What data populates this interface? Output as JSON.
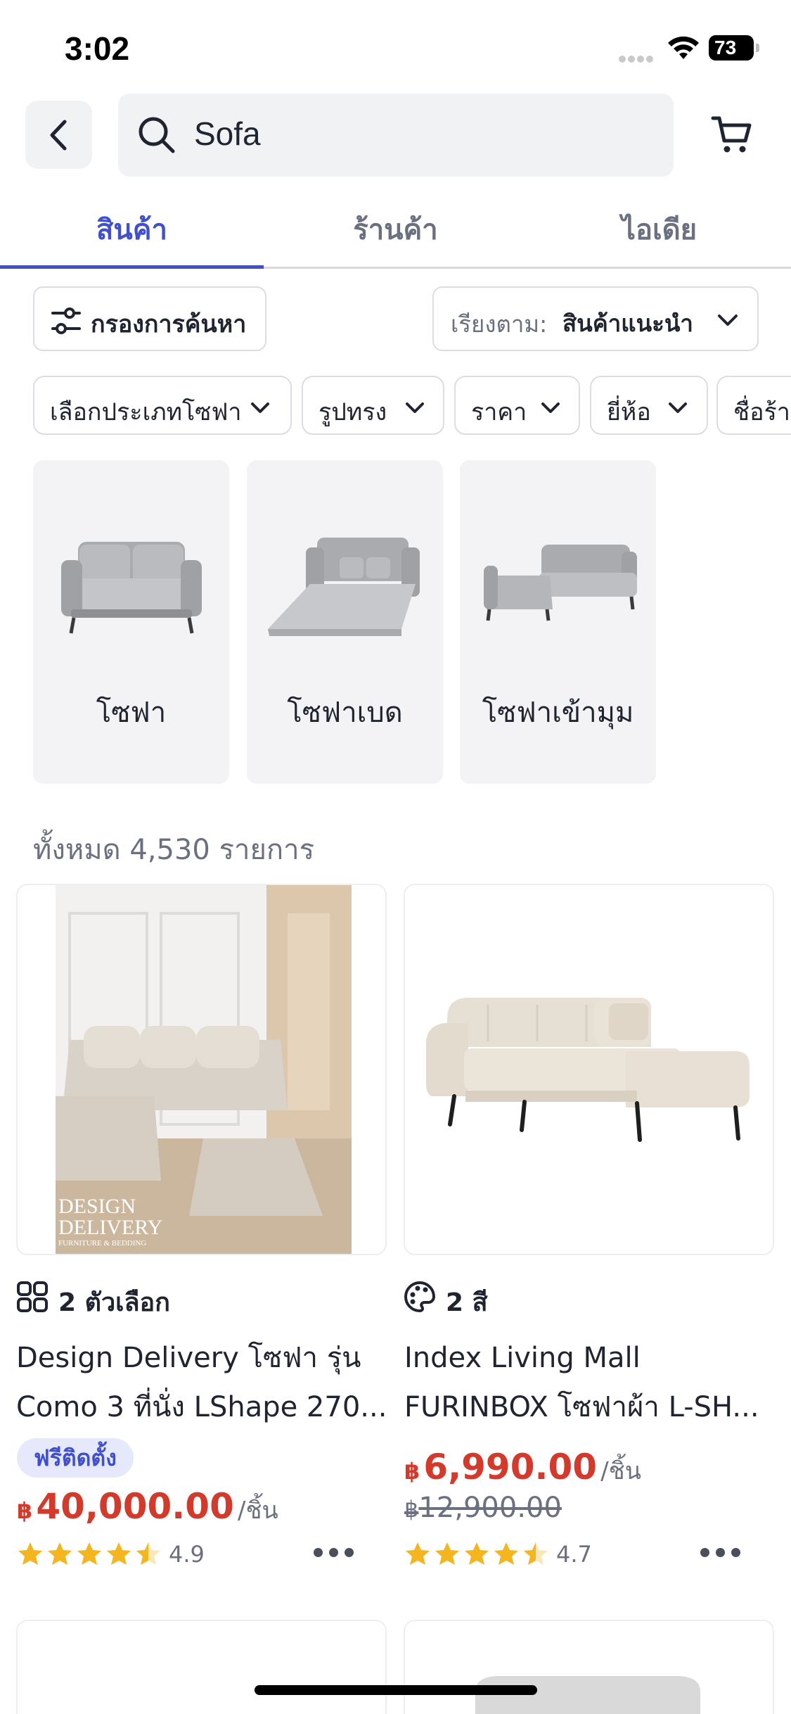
{
  "status_bar": {
    "time": "3:02",
    "battery": "73"
  },
  "search": {
    "query": "Sofa"
  },
  "tabs": [
    {
      "label": "สินค้า",
      "active": true
    },
    {
      "label": "ร้านค้า",
      "active": false
    },
    {
      "label": "ไอเดีย",
      "active": false
    }
  ],
  "filter": {
    "label": "กรองการค้นหา"
  },
  "sort": {
    "prefix": "เรียงตาม:",
    "value": "สินค้าแนะนำ"
  },
  "chips": [
    {
      "label": "เลือกประเภทโซฟา"
    },
    {
      "label": "รูปทรง"
    },
    {
      "label": "ราคา"
    },
    {
      "label": "ยี่ห้อ"
    },
    {
      "label": "ชื่อร้าน"
    }
  ],
  "categories": [
    {
      "label": "โซฟา",
      "icon": "sofa-image"
    },
    {
      "label": "โซฟาเบด",
      "icon": "sofa-bed-image"
    },
    {
      "label": "โซฟาเข้ามุม",
      "icon": "corner-sofa-image"
    }
  ],
  "result_count": "ทั้งหมด 4,530 รายการ",
  "products": [
    {
      "meta": "2 ตัวเลือก",
      "meta_icon": "options-grid-icon",
      "title_line1": "Design Delivery โซฟา รุ่น",
      "title_line2": "Como 3 ที่นั่ง LShape 270...",
      "badge": "ฟรีติดตั้ง",
      "currency": "฿",
      "price": "40,000.00",
      "unit": "/ชิ้น",
      "rating": "4.9",
      "image_watermark_line1": "DESIGN",
      "image_watermark_line2": "DELIVERY",
      "image_watermark_line3": "FURNITURE & BEDDING"
    },
    {
      "meta": "2 สี",
      "meta_icon": "palette-icon",
      "title_line1": "Index Living Mall",
      "title_line2": "FURINBOX โซฟาผ้า  L-SH...",
      "currency": "฿",
      "price": "6,990.00",
      "unit": "/ชิ้น",
      "old_currency": "฿",
      "old_price": "12,900.00",
      "rating": "4.7"
    }
  ],
  "colors": {
    "accent": "#3f4fd0",
    "price": "#d33a2c",
    "star": "#f5b51e",
    "chip_border": "#dcdde2",
    "card_bg": "#f3f3f5"
  }
}
